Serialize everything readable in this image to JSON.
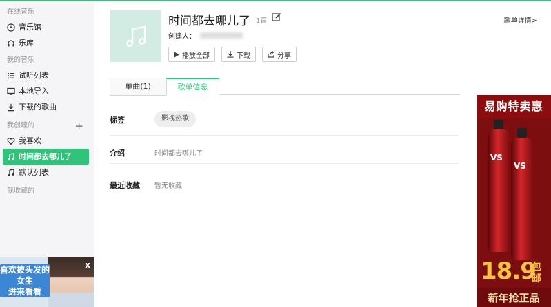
{
  "sidebar": {
    "online_title": "在线音乐",
    "online_items": [
      {
        "label": "音乐馆",
        "icon": "compass-icon"
      },
      {
        "label": "乐库",
        "icon": "headphones-icon"
      }
    ],
    "my_music_title": "我的音乐",
    "my_items": [
      {
        "label": "试听列表",
        "icon": "list-icon"
      },
      {
        "label": "本地导入",
        "icon": "monitor-icon"
      },
      {
        "label": "下载的歌曲",
        "icon": "download-icon"
      }
    ],
    "created_title": "我创建的",
    "created_plus": "+",
    "created_items": [
      {
        "label": "我喜欢",
        "icon": "heart-icon"
      },
      {
        "label": "时间都去哪儿了",
        "icon": "music-note-icon",
        "active": true
      },
      {
        "label": "默认列表",
        "icon": "music-note-icon"
      }
    ],
    "collected_title": "我收藏的"
  },
  "promo": {
    "text_line1": "喜欢披头发的",
    "text_line2": "女生",
    "text_line3": "进来看看",
    "close": "x"
  },
  "playlist": {
    "title": "时间都去哪儿了",
    "count": "1首",
    "creator_label": "创建人：",
    "detail_link": "歌单详情>",
    "buttons": {
      "play_all": "播放全部",
      "download": "下载",
      "share": "分享"
    }
  },
  "tabs": [
    {
      "label": "单曲(1)"
    },
    {
      "label": "歌单信息",
      "active": true
    }
  ],
  "info": {
    "tags_label": "标签",
    "tag_chip": "影视热歌",
    "intro_label": "介绍",
    "intro_value": "时间都去哪儿了",
    "recent_label": "最近收藏",
    "recent_value": "暂无收藏"
  },
  "ad": {
    "header": "易购特卖惠",
    "brand": "VS",
    "price": "18.9",
    "price_suffix": "包邮",
    "footer": "新年抢正品"
  },
  "colors": {
    "accent": "#31c27c",
    "ad_red": "#7c0e10",
    "ad_gold": "#f6c343"
  }
}
